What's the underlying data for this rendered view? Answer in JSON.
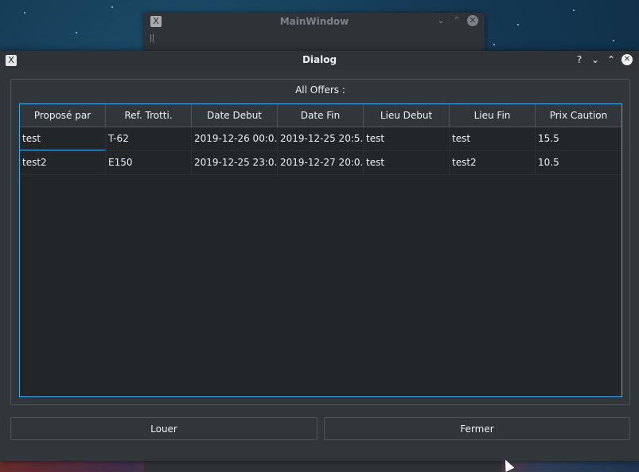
{
  "main_window": {
    "title": "MainWindow",
    "app_icon_glyph": "X",
    "buttons": {
      "minimize": "⌄",
      "maximize": "⌃",
      "close": "✕"
    }
  },
  "dialog": {
    "title": "Dialog",
    "app_icon_glyph": "X",
    "buttons": {
      "help": "?",
      "minimize": "⌄",
      "maximize": "⌃",
      "close": "✕"
    },
    "group_title": "All Offers :",
    "table": {
      "headers": [
        "Proposé par",
        "Ref. Trotti.",
        "Date Debut",
        "Date Fin",
        "Lieu Debut",
        "Lieu Fin",
        "Prix Caution"
      ],
      "rows": [
        [
          "test",
          "T-62",
          "2019-12-26 00:0...",
          "2019-12-25 20:5...",
          "test",
          "test",
          "15.5"
        ],
        [
          "test2",
          "E150",
          "2019-12-25 23:0...",
          "2019-12-27 20:0...",
          "test",
          "test2",
          "10.5"
        ]
      ]
    },
    "actions": {
      "louer": "Louer",
      "fermer": "Fermer"
    }
  },
  "colors": {
    "window_bg": "#31363b",
    "table_bg": "#232629",
    "accent": "#3daee9",
    "text": "#eff0f1"
  }
}
